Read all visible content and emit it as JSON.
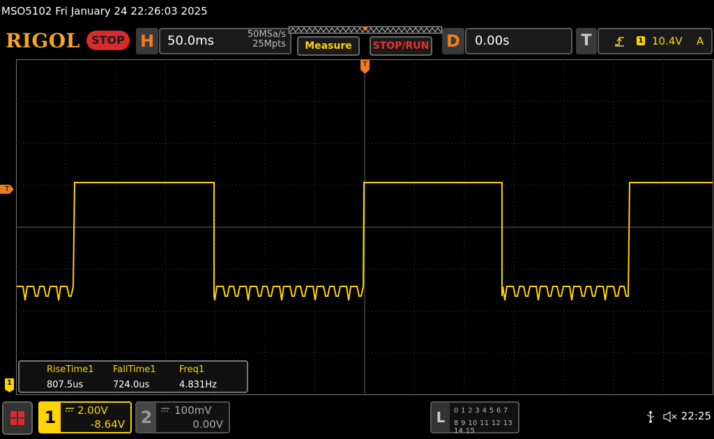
{
  "title": "MSO5102  Fri January 24 22:26:03 2025",
  "logo": "RIGOL",
  "run_state": "STOP",
  "horizontal": {
    "letter": "H",
    "timebase": "50.0ms",
    "sample_rate": "50MSa/s",
    "memory_depth": "25Mpts"
  },
  "buttons": {
    "measure": "Measure",
    "stop_run": "STOP/RUN"
  },
  "delay": {
    "letter": "D",
    "value": "0.00s"
  },
  "trigger": {
    "letter": "T",
    "source": "1",
    "level": "10.4V",
    "mode": "A"
  },
  "markers": {
    "trigger_time": "T",
    "trigger_level": "T",
    "ch1_ground": "1"
  },
  "measurements": {
    "headers": [
      "RiseTime1",
      "FallTime1",
      "Freq1"
    ],
    "values": [
      "807.5us",
      "724.0us",
      "4.831Hz"
    ]
  },
  "channels": [
    {
      "number": "1",
      "scale": "2.00V",
      "offset": "-8.64V",
      "color": "#ffd400",
      "active": true
    },
    {
      "number": "2",
      "scale": "100mV",
      "offset": "0.00V",
      "color": "#888888",
      "active": false
    }
  ],
  "logic_analyzer": {
    "letter": "L",
    "row1": "0 1 2 3   4 5 6 7",
    "row2": "8 9 10 11  12 13 14 15"
  },
  "status": {
    "clock": "22:25"
  },
  "colors": {
    "accent": "#f07c1e",
    "ch1": "#ffd400",
    "stop": "#d82b2b"
  }
}
